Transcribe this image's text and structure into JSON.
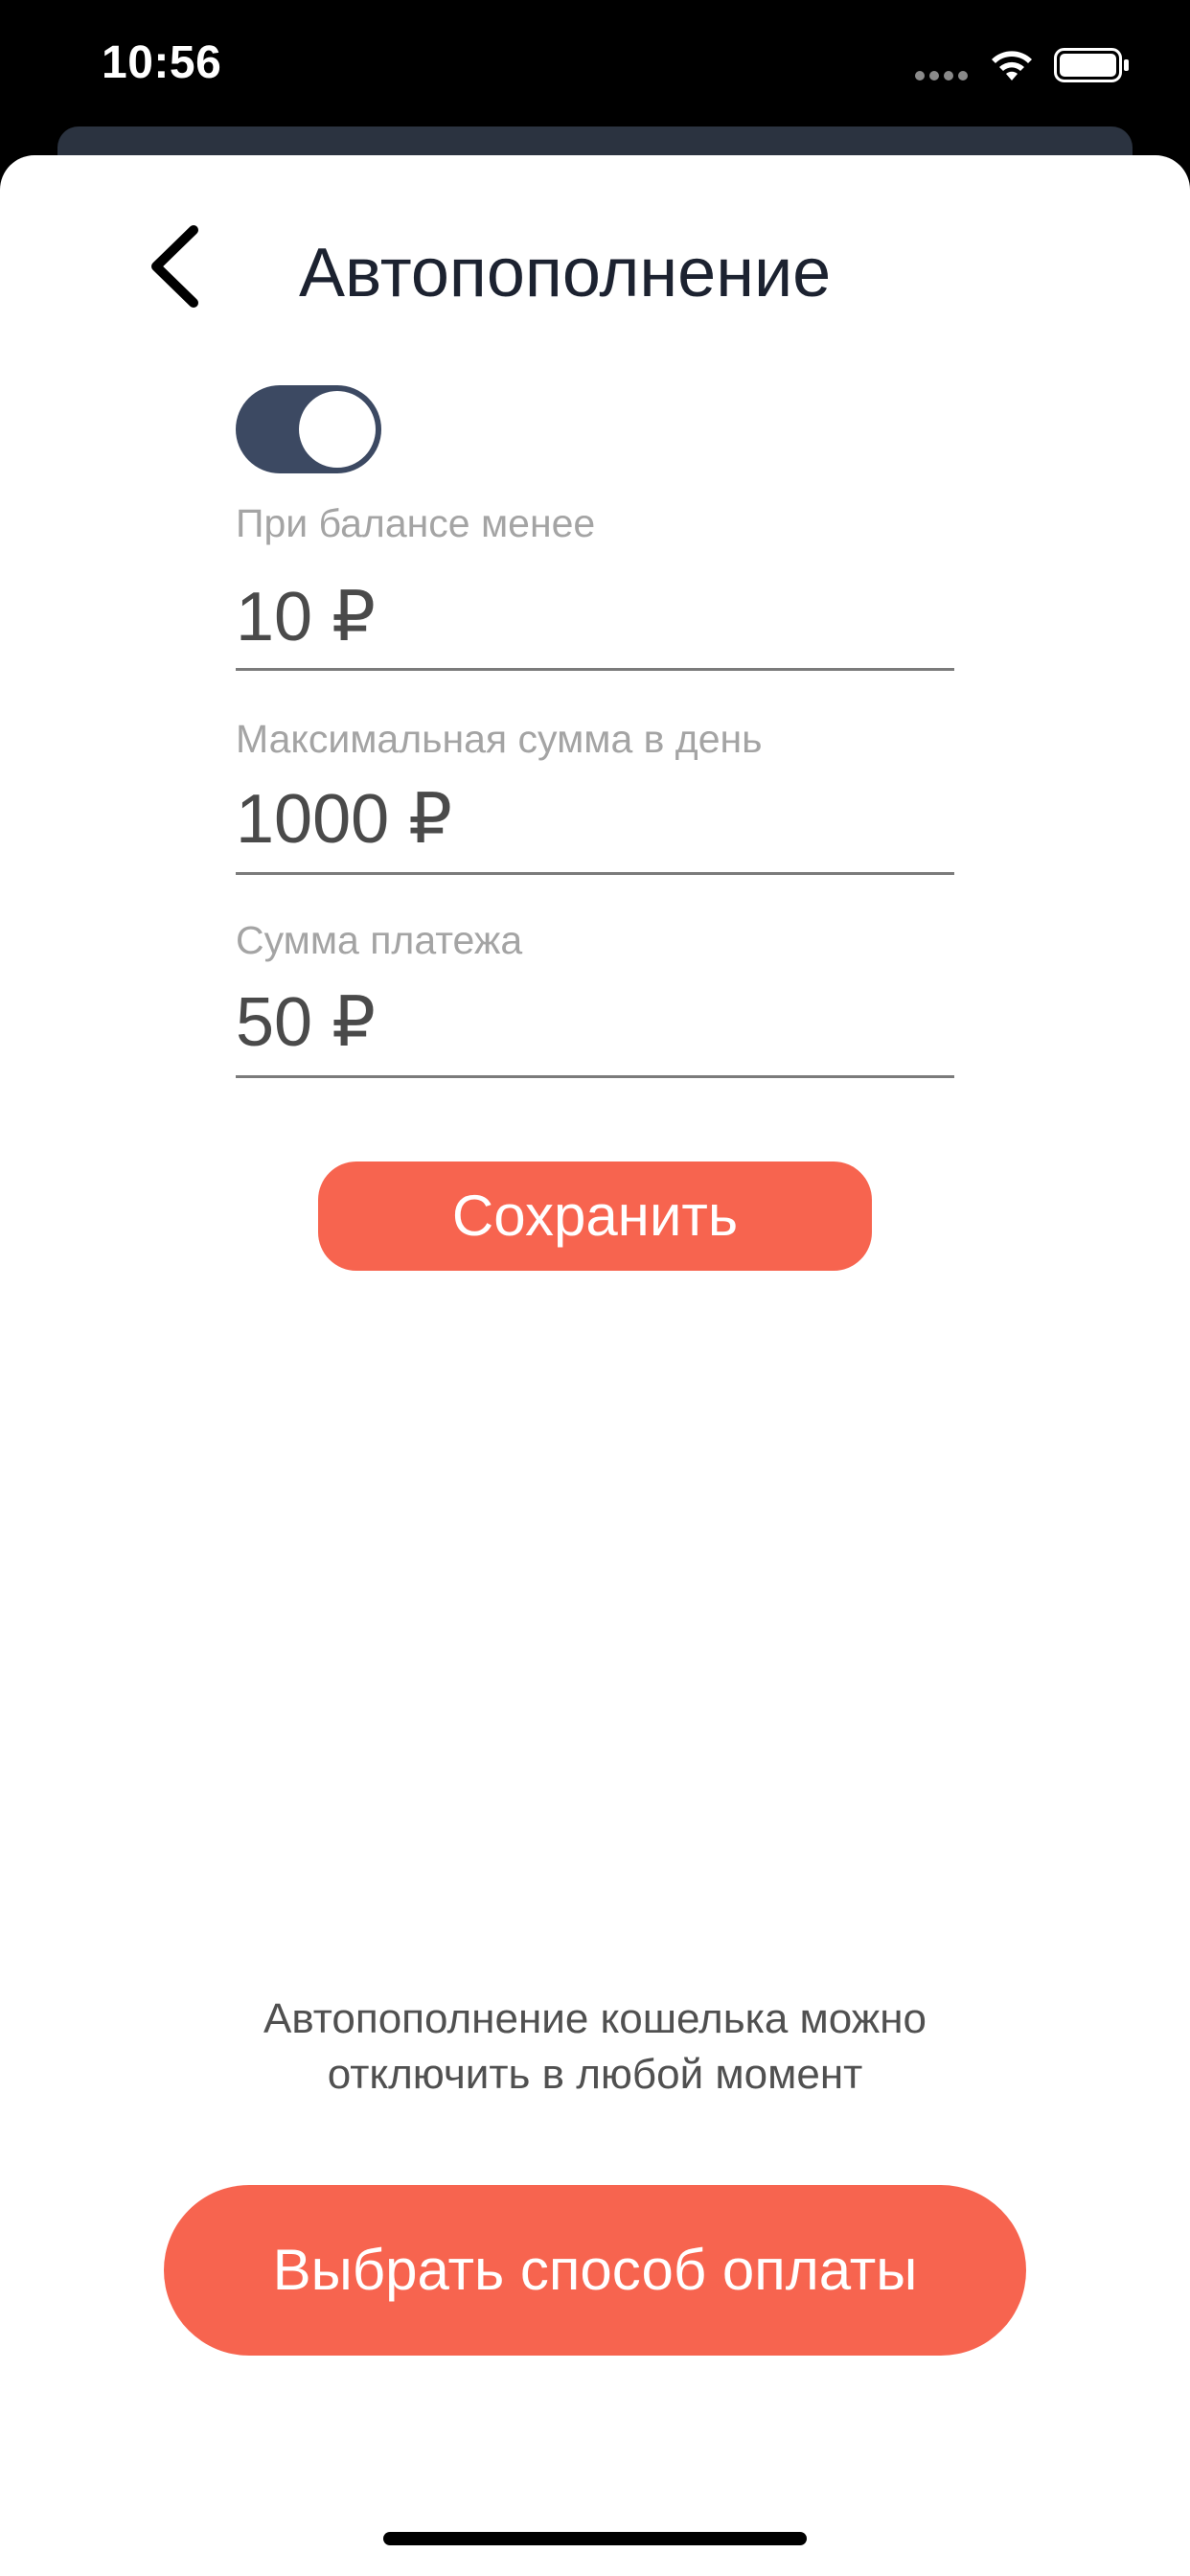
{
  "status_bar": {
    "time": "10:56",
    "icons": [
      "signal-icon",
      "wifi-icon",
      "battery-icon"
    ]
  },
  "header": {
    "back_icon": "chevron-left-icon",
    "title": "Автопополнение"
  },
  "auto_topup_toggle": {
    "on": true,
    "color": "#3c4962"
  },
  "fields": [
    {
      "label": "При балансе менее",
      "value": "10 ₽"
    },
    {
      "label": "Максимальная сумма в день",
      "value": "1000 ₽"
    },
    {
      "label": "Сумма платежа",
      "value": "50 ₽"
    }
  ],
  "save_button": {
    "label": "Сохранить",
    "color": "#f7644f"
  },
  "note": {
    "line1": "Автопополнение кошелька можно",
    "line2": "отключить в любой момент"
  },
  "pay_button": {
    "label": "Выбрать способ оплаты",
    "color": "#f7644f"
  }
}
